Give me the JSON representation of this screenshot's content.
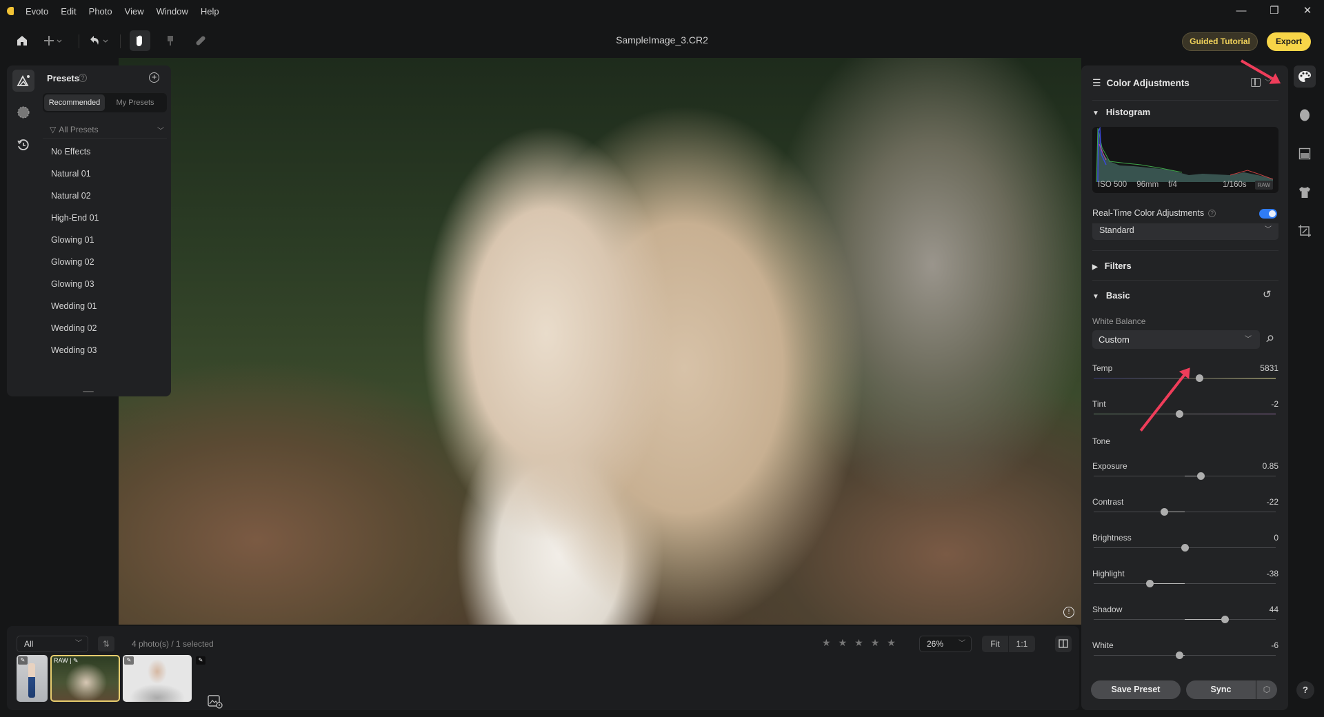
{
  "app": {
    "name": "Evoto",
    "menu": [
      "Evoto",
      "Edit",
      "Photo",
      "View",
      "Window",
      "Help"
    ],
    "window_controls": {
      "minimize": "—",
      "restore": "❐",
      "close": "✕"
    }
  },
  "toolbar": {
    "file_title": "SampleImage_3.CR2",
    "icons": [
      "home-icon",
      "add-icon",
      "undo-icon",
      "hand-icon",
      "brush-icon",
      "healing-icon"
    ],
    "guided_tutorial_label": "Guided Tutorial",
    "export_label": "Export"
  },
  "left_rail": {
    "icons": [
      "presets-icon",
      "masks-icon",
      "history-icon"
    ]
  },
  "presets": {
    "title": "Presets",
    "help": "?",
    "add": "+",
    "tabs": [
      {
        "label": "Recommended",
        "active": true
      },
      {
        "label": "My Presets",
        "active": false
      }
    ],
    "filter_label": "All Presets",
    "items": [
      "No Effects",
      "Natural 01",
      "Natural 02",
      "High-End 01",
      "Glowing 01",
      "Glowing 02",
      "Glowing 03",
      "Wedding 01",
      "Wedding 02",
      "Wedding 03"
    ]
  },
  "filmstrip": {
    "filter_value": "All",
    "sort_icon": "⇅",
    "count_text": "4 photo(s) / 1 selected",
    "thumbnails": [
      {
        "badge": "✎",
        "selected": false
      },
      {
        "badge": "RAW | ✎",
        "selected": true
      },
      {
        "badge": "✎",
        "selected": false
      },
      {
        "badge": "✎",
        "selected": false
      }
    ],
    "rating": {
      "value": 0,
      "max": 5,
      "star": "★"
    },
    "zoom_value": "26%",
    "fit_label": "Fit",
    "one_to_one_label": "1:1"
  },
  "color_panel": {
    "title": "Color Adjustments",
    "histogram": {
      "title": "Histogram",
      "iso": "ISO 500",
      "focal": "96mm",
      "aperture": "f/4",
      "shutter": "1/160s",
      "format": "RAW"
    },
    "realtime_label": "Real-Time Color Adjustments",
    "realtime_enabled": true,
    "profile_value": "Standard",
    "filters_title": "Filters",
    "basic_title": "Basic",
    "white_balance_label": "White Balance",
    "white_balance_value": "Custom",
    "tone_label": "Tone",
    "sliders": [
      {
        "label": "Temp",
        "value": "5831",
        "position": 0.58
      },
      {
        "label": "Tint",
        "value": "-2",
        "position": 0.47
      },
      {
        "label": "Exposure",
        "value": "0.85",
        "position": 0.59
      },
      {
        "label": "Contrast",
        "value": "-22",
        "position": 0.39
      },
      {
        "label": "Brightness",
        "value": "0",
        "position": 0.5
      },
      {
        "label": "Highlight",
        "value": "-38",
        "position": 0.31
      },
      {
        "label": "Shadow",
        "value": "44",
        "position": 0.72
      },
      {
        "label": "White",
        "value": "-6",
        "position": 0.47
      }
    ],
    "save_preset_label": "Save Preset",
    "sync_label": "Sync"
  },
  "right_rail": {
    "icons": [
      "color-palette-icon",
      "face-icon",
      "background-icon",
      "clothing-icon",
      "crop-icon"
    ]
  },
  "help_label": "?",
  "annotation_color": "#ef3d5a"
}
